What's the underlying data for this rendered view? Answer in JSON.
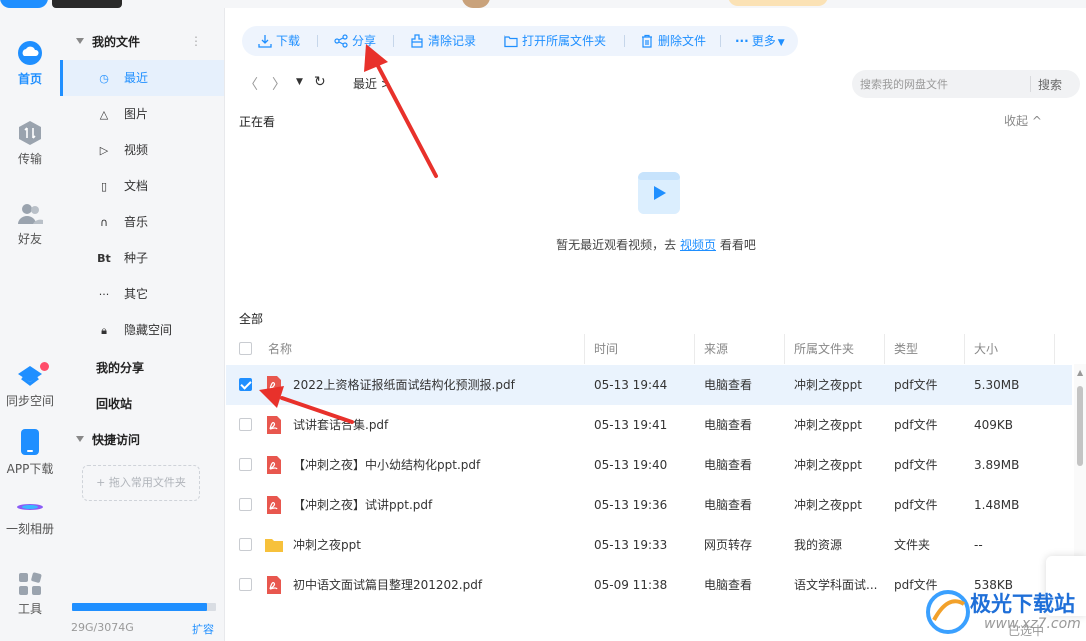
{
  "colors": {
    "accent": "#1f8fff",
    "annotation": "#e8312b",
    "pdf": "#e8574e",
    "folder": "#f7c13b"
  },
  "rail": {
    "items": [
      {
        "label": "首页",
        "icon": "cloud-icon"
      },
      {
        "label": "传输",
        "icon": "transfer-icon"
      },
      {
        "label": "好友",
        "icon": "friends-icon"
      },
      {
        "label": "同步空间",
        "icon": "sync-icon"
      },
      {
        "label": "APP下载",
        "icon": "phone-icon"
      },
      {
        "label": "一刻相册",
        "icon": "album-icon"
      },
      {
        "label": "工具",
        "icon": "tools-icon"
      }
    ]
  },
  "sidebar": {
    "my_files": "我的文件",
    "items": [
      {
        "label": "最近",
        "icon": "clock-icon"
      },
      {
        "label": "图片",
        "icon": "image-icon"
      },
      {
        "label": "视频",
        "icon": "play-icon"
      },
      {
        "label": "文档",
        "icon": "doc-icon"
      },
      {
        "label": "音乐",
        "icon": "headphones-icon"
      },
      {
        "label": "种子",
        "icon": "bt-icon"
      },
      {
        "label": "其它",
        "icon": "more-icon"
      },
      {
        "label": "隐藏空间",
        "icon": "lock-icon"
      }
    ],
    "my_share": "我的分享",
    "recycle": "回收站",
    "quick_access": "快捷访问",
    "quick_add": "+ 拖入常用文件夹",
    "storage": "29G/3074G",
    "storage_fraction": 0.94,
    "expand": "扩容"
  },
  "toolbar": {
    "download": "下载",
    "share": "分享",
    "clear": "清除记录",
    "open_folder": "打开所属文件夹",
    "delete": "删除文件",
    "more": "更多"
  },
  "nav": {
    "breadcrumb": "最近",
    "search_placeholder": "搜索我的网盘文件",
    "search_btn": "搜索"
  },
  "watching": {
    "title": "正在看",
    "collapse": "收起",
    "empty_prefix": "暂无最近观看视频，去",
    "empty_link": "视频页",
    "empty_suffix": "看看吧"
  },
  "table": {
    "title": "全部",
    "headers": {
      "name": "名称",
      "time": "时间",
      "source": "来源",
      "folder": "所属文件夹",
      "type": "类型",
      "size": "大小"
    },
    "rows": [
      {
        "name": "2022上资格证报纸面试结构化预测报.pdf",
        "time": "05-13 19:44",
        "source": "电脑查看",
        "folder": "冲刺之夜ppt",
        "type": "pdf文件",
        "size": "5.30MB",
        "kind": "pdf",
        "checked": true
      },
      {
        "name": "试讲套话合集.pdf",
        "time": "05-13 19:41",
        "source": "电脑查看",
        "folder": "冲刺之夜ppt",
        "type": "pdf文件",
        "size": "409KB",
        "kind": "pdf",
        "checked": false
      },
      {
        "name": "【冲刺之夜】中小幼结构化ppt.pdf",
        "time": "05-13 19:40",
        "source": "电脑查看",
        "folder": "冲刺之夜ppt",
        "type": "pdf文件",
        "size": "3.89MB",
        "kind": "pdf",
        "checked": false
      },
      {
        "name": "【冲刺之夜】试讲ppt.pdf",
        "time": "05-13 19:36",
        "source": "电脑查看",
        "folder": "冲刺之夜ppt",
        "type": "pdf文件",
        "size": "1.48MB",
        "kind": "pdf",
        "checked": false
      },
      {
        "name": "冲刺之夜ppt",
        "time": "05-13 19:33",
        "source": "网页转存",
        "folder": "我的资源",
        "type": "文件夹",
        "size": "--",
        "kind": "folder",
        "checked": false
      },
      {
        "name": "初中语文面试篇目整理201202.pdf",
        "time": "05-09 11:38",
        "source": "电脑查看",
        "folder": "语文学科面试...",
        "type": "pdf文件",
        "size": "538KB",
        "kind": "pdf",
        "checked": false
      }
    ]
  },
  "footer": {
    "selected": "已选中"
  },
  "watermark": {
    "brand": "极光下载站",
    "url": "www.xz7.com"
  }
}
